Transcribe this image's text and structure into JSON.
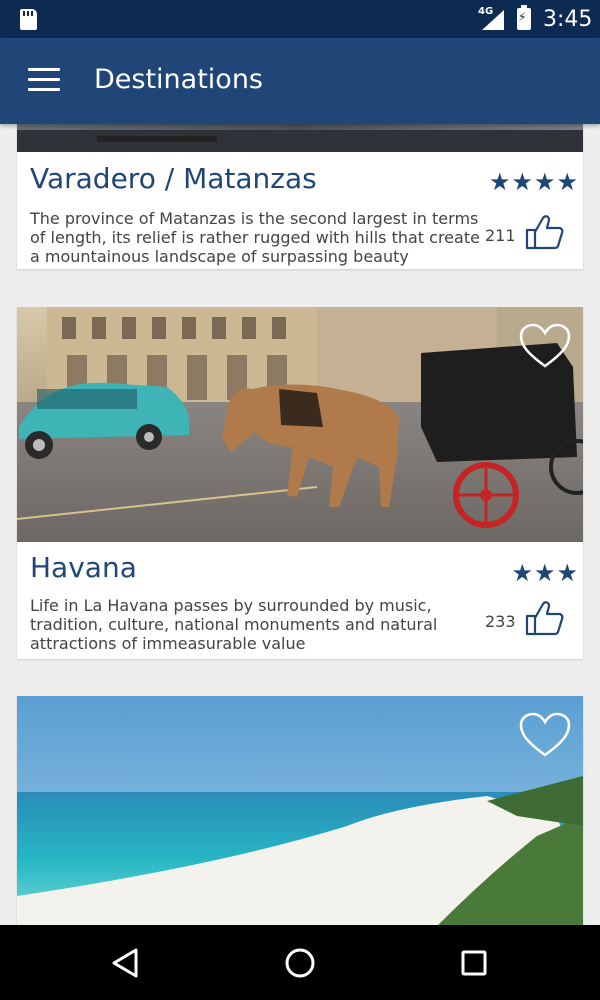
{
  "status_bar": {
    "time": "3:45",
    "network": "4G",
    "icons": [
      "sd-card-icon",
      "signal-icon",
      "battery-charging-icon"
    ]
  },
  "app_bar": {
    "title": "Destinations",
    "menu_icon": "hamburger-menu-icon"
  },
  "destinations": [
    {
      "name": "Varadero / Matanzas",
      "description": "The province of Matanzas is the second largest in terms of length, its relief is rather rugged with hills that create a mountainous landscape of surpassing beauty",
      "stars": "★★★★",
      "rating": 4,
      "likes": "211"
    },
    {
      "name": "Havana",
      "description": "Life in La Havana passes by surrounded by music, tradition, culture, national monuments and natural attractions of immeasurable value",
      "stars": "★★★",
      "rating": 3,
      "likes": "233"
    },
    {
      "name": "",
      "image": "beach"
    }
  ],
  "nav_bar": {
    "buttons": [
      "back-icon",
      "home-icon",
      "recents-icon"
    ]
  },
  "colors": {
    "status_bar": "#0d2a52",
    "app_bar": "#1f4677",
    "accent": "#1f4677"
  }
}
